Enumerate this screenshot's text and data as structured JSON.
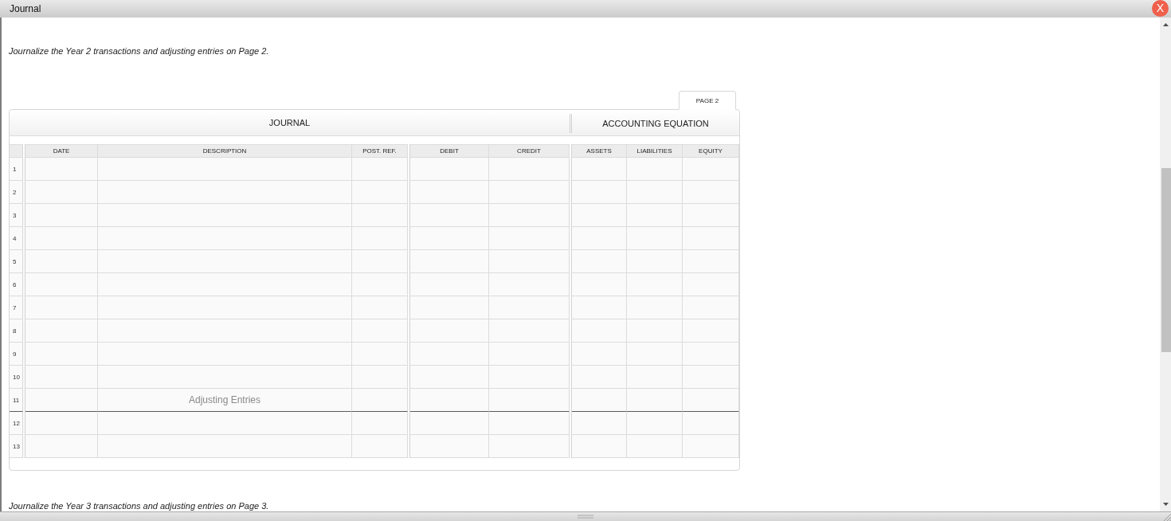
{
  "window": {
    "title": "Journal",
    "close_button": "X"
  },
  "instruction": "Journalize the Year 2 transactions and adjusting entries on Page 2.",
  "journal": {
    "tabs": [
      {
        "label": "PAGE 2",
        "selected": true
      }
    ],
    "sections": [
      {
        "title": "JOURNAL",
        "blocks": [
          {
            "columns": [
              "DATE",
              "DESCRIPTION",
              "POST. REF."
            ]
          },
          {
            "columns": [
              "DEBIT",
              "CREDIT"
            ]
          }
        ]
      },
      {
        "title": "ACCOUNTING EQUATION",
        "blocks": [
          {
            "columns": [
              "ASSETS",
              "LIABILITIES",
              "EQUITY"
            ]
          }
        ]
      }
    ],
    "rows": [
      {
        "number": "1",
        "rule_below": false
      },
      {
        "number": "2",
        "rule_below": false
      },
      {
        "number": "3",
        "rule_below": false
      },
      {
        "number": "4",
        "rule_below": false
      },
      {
        "number": "5",
        "rule_below": false
      },
      {
        "number": "6",
        "rule_below": false
      },
      {
        "number": "7",
        "rule_below": false
      },
      {
        "number": "8",
        "rule_below": false
      },
      {
        "number": "9",
        "rule_below": false
      },
      {
        "number": "10",
        "rule_below": false
      },
      {
        "number": "11",
        "description": "Adjusting Entries",
        "rule_below": true
      },
      {
        "number": "12",
        "rule_below": false
      },
      {
        "number": "13",
        "rule_below": false
      }
    ]
  },
  "next_instruction": "Journalize the Year 3 transactions and adjusting entries on Page 3."
}
